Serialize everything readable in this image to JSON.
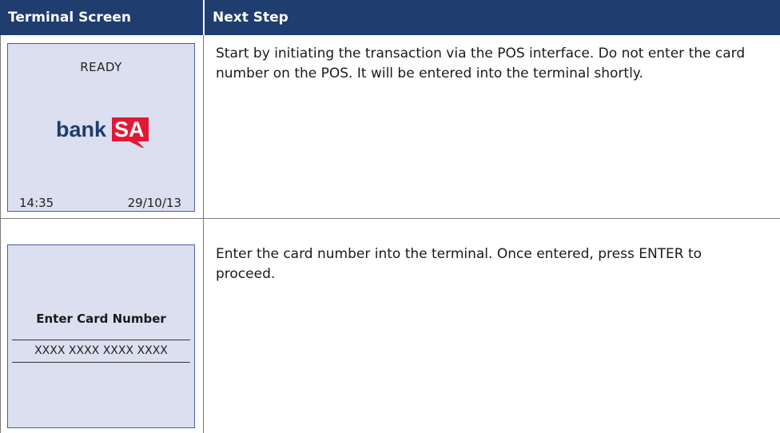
{
  "header": {
    "col1": "Terminal Screen",
    "col2": "Next Step"
  },
  "rows": [
    {
      "screen": {
        "status": "READY",
        "logo_text_left": "bank",
        "logo_text_right": "SA",
        "time": "14:35",
        "date": "29/10/13"
      },
      "step": "Start by initiating the transaction via the POS interface. Do not enter the card number on the POS. It will be entered into the terminal shortly."
    },
    {
      "screen": {
        "prompt": "Enter Card Number",
        "card_mask": "XXXX XXXX XXXX XXXX"
      },
      "step": "Enter the card number into the terminal. Once entered, press ENTER to proceed."
    }
  ],
  "colors": {
    "header_bg": "#1f3d6e",
    "screen_bg": "#dcdff0",
    "brand_navy": "#1f3d6e",
    "brand_red": "#e31837"
  }
}
